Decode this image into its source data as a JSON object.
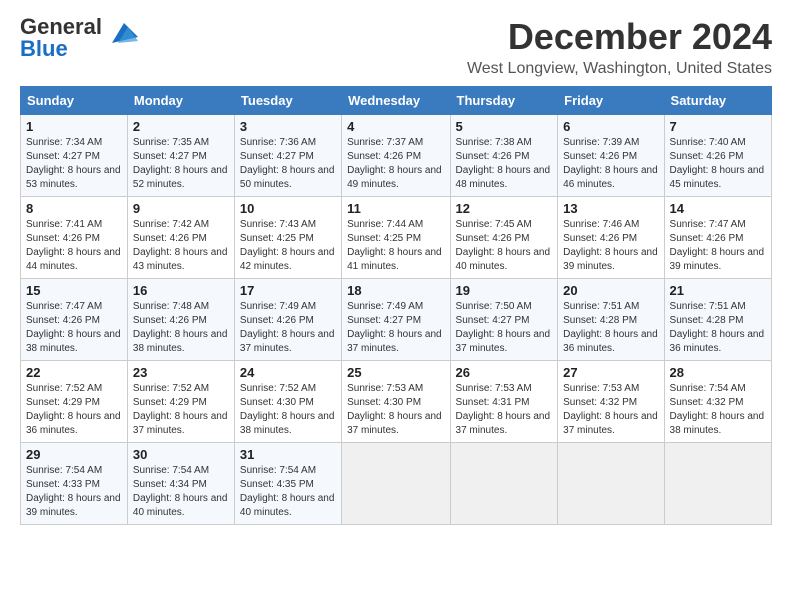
{
  "logo": {
    "general": "General",
    "blue": "Blue"
  },
  "header": {
    "month": "December 2024",
    "location": "West Longview, Washington, United States"
  },
  "weekdays": [
    "Sunday",
    "Monday",
    "Tuesday",
    "Wednesday",
    "Thursday",
    "Friday",
    "Saturday"
  ],
  "weeks": [
    [
      {
        "day": "1",
        "sunrise": "7:34 AM",
        "sunset": "4:27 PM",
        "daylight": "8 hours and 53 minutes."
      },
      {
        "day": "2",
        "sunrise": "7:35 AM",
        "sunset": "4:27 PM",
        "daylight": "8 hours and 52 minutes."
      },
      {
        "day": "3",
        "sunrise": "7:36 AM",
        "sunset": "4:27 PM",
        "daylight": "8 hours and 50 minutes."
      },
      {
        "day": "4",
        "sunrise": "7:37 AM",
        "sunset": "4:26 PM",
        "daylight": "8 hours and 49 minutes."
      },
      {
        "day": "5",
        "sunrise": "7:38 AM",
        "sunset": "4:26 PM",
        "daylight": "8 hours and 48 minutes."
      },
      {
        "day": "6",
        "sunrise": "7:39 AM",
        "sunset": "4:26 PM",
        "daylight": "8 hours and 46 minutes."
      },
      {
        "day": "7",
        "sunrise": "7:40 AM",
        "sunset": "4:26 PM",
        "daylight": "8 hours and 45 minutes."
      }
    ],
    [
      {
        "day": "8",
        "sunrise": "7:41 AM",
        "sunset": "4:26 PM",
        "daylight": "8 hours and 44 minutes."
      },
      {
        "day": "9",
        "sunrise": "7:42 AM",
        "sunset": "4:26 PM",
        "daylight": "8 hours and 43 minutes."
      },
      {
        "day": "10",
        "sunrise": "7:43 AM",
        "sunset": "4:25 PM",
        "daylight": "8 hours and 42 minutes."
      },
      {
        "day": "11",
        "sunrise": "7:44 AM",
        "sunset": "4:25 PM",
        "daylight": "8 hours and 41 minutes."
      },
      {
        "day": "12",
        "sunrise": "7:45 AM",
        "sunset": "4:26 PM",
        "daylight": "8 hours and 40 minutes."
      },
      {
        "day": "13",
        "sunrise": "7:46 AM",
        "sunset": "4:26 PM",
        "daylight": "8 hours and 39 minutes."
      },
      {
        "day": "14",
        "sunrise": "7:47 AM",
        "sunset": "4:26 PM",
        "daylight": "8 hours and 39 minutes."
      }
    ],
    [
      {
        "day": "15",
        "sunrise": "7:47 AM",
        "sunset": "4:26 PM",
        "daylight": "8 hours and 38 minutes."
      },
      {
        "day": "16",
        "sunrise": "7:48 AM",
        "sunset": "4:26 PM",
        "daylight": "8 hours and 38 minutes."
      },
      {
        "day": "17",
        "sunrise": "7:49 AM",
        "sunset": "4:26 PM",
        "daylight": "8 hours and 37 minutes."
      },
      {
        "day": "18",
        "sunrise": "7:49 AM",
        "sunset": "4:27 PM",
        "daylight": "8 hours and 37 minutes."
      },
      {
        "day": "19",
        "sunrise": "7:50 AM",
        "sunset": "4:27 PM",
        "daylight": "8 hours and 37 minutes."
      },
      {
        "day": "20",
        "sunrise": "7:51 AM",
        "sunset": "4:28 PM",
        "daylight": "8 hours and 36 minutes."
      },
      {
        "day": "21",
        "sunrise": "7:51 AM",
        "sunset": "4:28 PM",
        "daylight": "8 hours and 36 minutes."
      }
    ],
    [
      {
        "day": "22",
        "sunrise": "7:52 AM",
        "sunset": "4:29 PM",
        "daylight": "8 hours and 36 minutes."
      },
      {
        "day": "23",
        "sunrise": "7:52 AM",
        "sunset": "4:29 PM",
        "daylight": "8 hours and 37 minutes."
      },
      {
        "day": "24",
        "sunrise": "7:52 AM",
        "sunset": "4:30 PM",
        "daylight": "8 hours and 38 minutes."
      },
      {
        "day": "25",
        "sunrise": "7:53 AM",
        "sunset": "4:30 PM",
        "daylight": "8 hours and 37 minutes."
      },
      {
        "day": "26",
        "sunrise": "7:53 AM",
        "sunset": "4:31 PM",
        "daylight": "8 hours and 37 minutes."
      },
      {
        "day": "27",
        "sunrise": "7:53 AM",
        "sunset": "4:32 PM",
        "daylight": "8 hours and 37 minutes."
      },
      {
        "day": "28",
        "sunrise": "7:54 AM",
        "sunset": "4:32 PM",
        "daylight": "8 hours and 38 minutes."
      }
    ],
    [
      {
        "day": "29",
        "sunrise": "7:54 AM",
        "sunset": "4:33 PM",
        "daylight": "8 hours and 39 minutes."
      },
      {
        "day": "30",
        "sunrise": "7:54 AM",
        "sunset": "4:34 PM",
        "daylight": "8 hours and 40 minutes."
      },
      {
        "day": "31",
        "sunrise": "7:54 AM",
        "sunset": "4:35 PM",
        "daylight": "8 hours and 40 minutes."
      },
      null,
      null,
      null,
      null
    ]
  ],
  "labels": {
    "sunrise": "Sunrise:",
    "sunset": "Sunset:",
    "daylight": "Daylight:"
  }
}
